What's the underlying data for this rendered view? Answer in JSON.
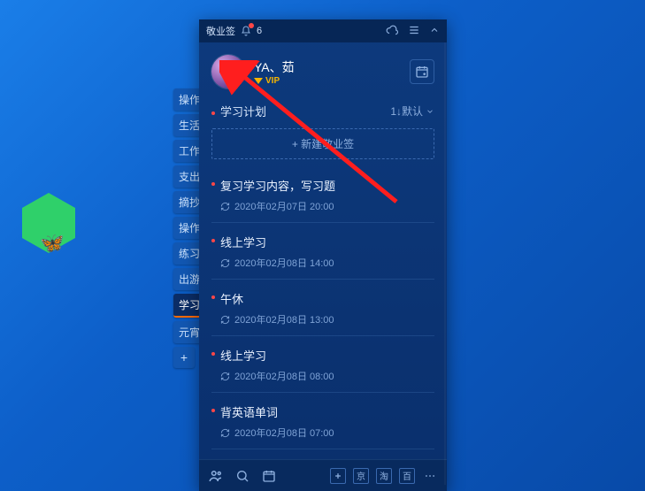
{
  "titlebar": {
    "app_name": "敬业签",
    "badge_count": "6"
  },
  "profile": {
    "nickname": "YA、茹",
    "vip_label": "VIP"
  },
  "section": {
    "title": "学习计划",
    "sort_label": "1↓默认"
  },
  "new_note_label": "+ 新建敬业签",
  "side_tabs": [
    "操作",
    "生活",
    "工作",
    "支出",
    "摘抄",
    "操作",
    "练习",
    "出游",
    "学习计划",
    "元宵"
  ],
  "side_tab_plus": "+",
  "items": [
    {
      "title": "复习学习内容，写习题",
      "time": "2020年02月07日 20:00"
    },
    {
      "title": "线上学习",
      "time": "2020年02月08日 14:00"
    },
    {
      "title": "午休",
      "time": "2020年02月08日 13:00"
    },
    {
      "title": "线上学习",
      "time": "2020年02月08日 08:00"
    },
    {
      "title": "背英语单词",
      "time": "2020年02月08日 07:00"
    }
  ],
  "footer": {
    "box_labels": [
      "京",
      "淘",
      "百"
    ]
  }
}
